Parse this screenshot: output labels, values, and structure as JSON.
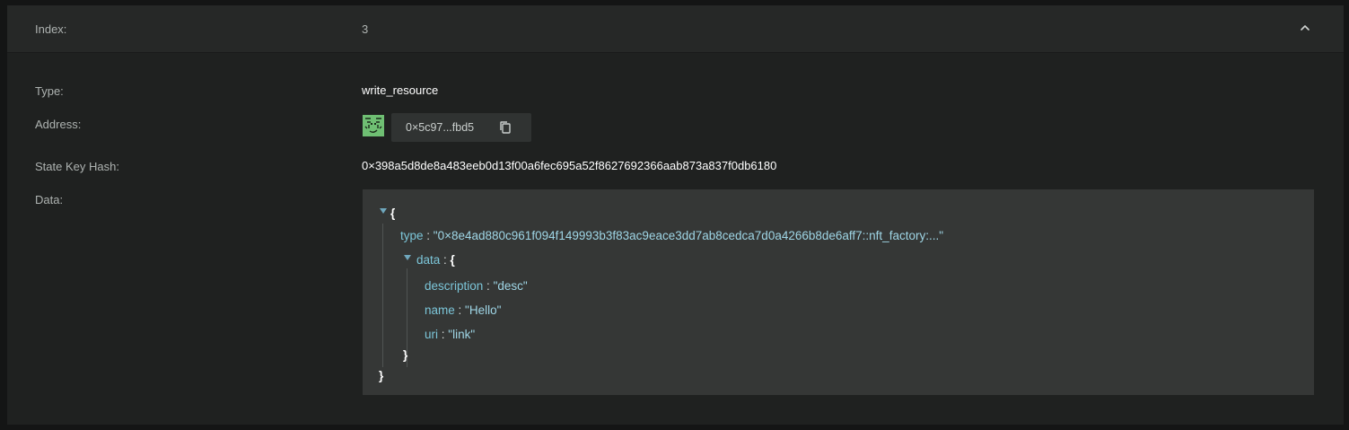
{
  "header": {
    "index_label": "Index:",
    "index_value": "3"
  },
  "fields": {
    "type_label": "Type:",
    "type_value": "write_resource",
    "address_label": "Address:",
    "address_value": "0×5c97...fbd5",
    "state_key_hash_label": "State Key Hash:",
    "state_key_hash_value": "0×398a5d8de8a483eeb0d13f00a6fec695a52f8627692366aab873a837f0db6180",
    "data_label": "Data:"
  },
  "json_view": {
    "open_brace": "{",
    "close_brace": "}",
    "type_key": "type",
    "type_value": "\"0×8e4ad880c961f094f149993b3f83ac9eace3dd7ab8cedca7d0a4266b8de6aff7::nft_factory:...\"",
    "data_key": "data",
    "data_children": [
      {
        "key": "description",
        "value": "\"desc\""
      },
      {
        "key": "name",
        "value": "\"Hello\""
      },
      {
        "key": "uri",
        "value": "\"link\""
      }
    ],
    "separator": " : "
  },
  "icons": {
    "collapse": "chevron-up-icon",
    "copy": "copy-icon",
    "avatar": "identicon-avatar",
    "tree_toggle": "caret-down-icon"
  },
  "colors": {
    "background": "#141515",
    "card": "#1f2120",
    "header": "#262827",
    "json_box": "#353736",
    "key": "#7cc6d9",
    "identicon": "#6fbf73"
  }
}
